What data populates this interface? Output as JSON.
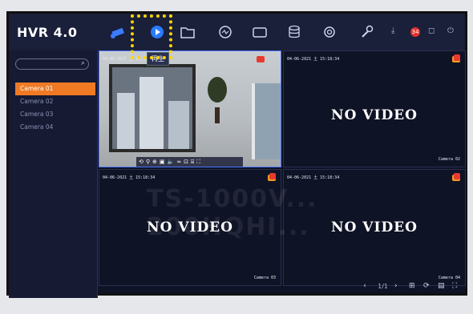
{
  "app": {
    "title": "HVR 4.0"
  },
  "topbar": {
    "icons": [
      "camera-icon",
      "playback-icon",
      "folder-icon",
      "analytics-icon",
      "tv-icon",
      "storage-icon",
      "settings-icon",
      "wrench-icon"
    ],
    "tooltip": "再生",
    "right": {
      "badge_count": "34"
    }
  },
  "sidebar": {
    "search_placeholder": "",
    "cameras": [
      "Camera 01",
      "Camera 02",
      "Camera 03",
      "Camera 04"
    ],
    "active_index": 0
  },
  "grid": {
    "cells": [
      {
        "timestamp": "04-06-2021 土 15:18:34",
        "type": "live",
        "label": ""
      },
      {
        "timestamp": "04-06-2021 土 15:18:34",
        "type": "no-video",
        "text": "NO VIDEO",
        "label": "Camera 02"
      },
      {
        "timestamp": "04-06-2021 土 15:18:34",
        "type": "no-video",
        "text": "NO VIDEO",
        "label": "Camera 03"
      },
      {
        "timestamp": "04-06-2021 土 15:18:34",
        "type": "no-video",
        "text": "NO VIDEO",
        "label": "Camera 04"
      }
    ]
  },
  "pager": {
    "page": "1/1"
  },
  "watermark": "TS-1000V... 200HQHI..."
}
